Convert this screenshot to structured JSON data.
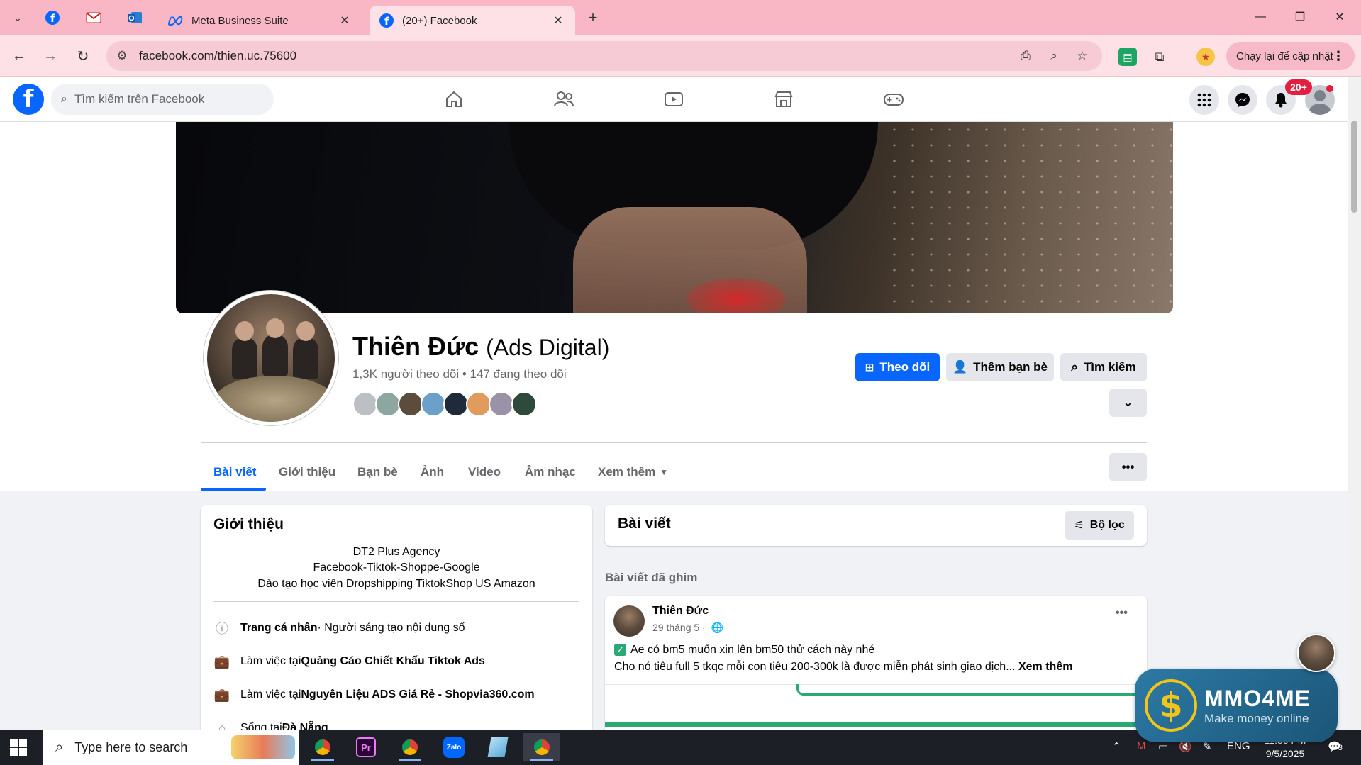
{
  "browser": {
    "tabs": [
      {
        "title": "Meta Business Suite",
        "active": false
      },
      {
        "title": "(20+) Facebook",
        "active": true
      }
    ],
    "new_tab": "+",
    "url": "facebook.com/thien.uc.75600",
    "update_button": "Chạy lại để cập nhật"
  },
  "facebook": {
    "search_placeholder": "Tìm kiếm trên Facebook",
    "notification_badge": "20+"
  },
  "profile": {
    "name": "Thiên Đức",
    "alternate_name": "(Ads Digital)",
    "stats": "1,3K người theo dõi • 147 đang theo dõi",
    "follow_button": "Theo dõi",
    "add_friend_button": "Thêm bạn bè",
    "search_button": "Tìm kiếm",
    "tabs": [
      {
        "label": "Bài viết",
        "active": true
      },
      {
        "label": "Giới thiệu",
        "active": false
      },
      {
        "label": "Bạn bè",
        "active": false
      },
      {
        "label": "Ảnh",
        "active": false
      },
      {
        "label": "Video",
        "active": false
      },
      {
        "label": "Âm nhạc",
        "active": false
      },
      {
        "label": "Xem thêm",
        "active": false
      }
    ]
  },
  "intro": {
    "title": "Giới thiệu",
    "bio": [
      "DT2 Plus Agency",
      "Facebook-Tiktok-Shoppe-Google",
      "Đào tạo học viên Dropshipping TiktokShop US Amazon"
    ],
    "rows": [
      {
        "bold": "Trang cá nhân",
        "rest": " · Người sáng tạo nội dung số"
      },
      {
        "prefix": "Làm việc tại ",
        "bold": "Quảng Cáo Chiết Khấu Tiktok Ads"
      },
      {
        "prefix": "Làm việc tại ",
        "bold": "Nguyên Liệu ADS Giá Rẻ - Shopvia360.com"
      },
      {
        "prefix": "Sống tại ",
        "bold": "Đà Nẵng"
      }
    ]
  },
  "posts": {
    "title": "Bài viết",
    "filter_button": "Bộ lọc",
    "pinned_label": "Bài viết đã ghim",
    "pinned_post": {
      "author": "Thiên Đức",
      "date": "29 tháng 5 ·",
      "line1": "Ae có bm5 muốn xin lên bm50 thử cách này nhé",
      "line2": "Cho nó tiêu full 5 tkqc mỗi con tiêu 200-300k là được miễn phát sinh giao dịch...",
      "see_more": "Xem thêm"
    }
  },
  "watermark": {
    "brand": "MMO4ME",
    "tagline": "Make money online"
  },
  "taskbar": {
    "search_placeholder": "Type here to search",
    "language": "ENG",
    "time": "11:36 PM",
    "date": "9/5/2025",
    "notification_count": "3"
  },
  "colors": {
    "fb_blue": "#0866ff",
    "tab_pink": "#f9b6c4",
    "badge_red": "#e41e3f"
  }
}
